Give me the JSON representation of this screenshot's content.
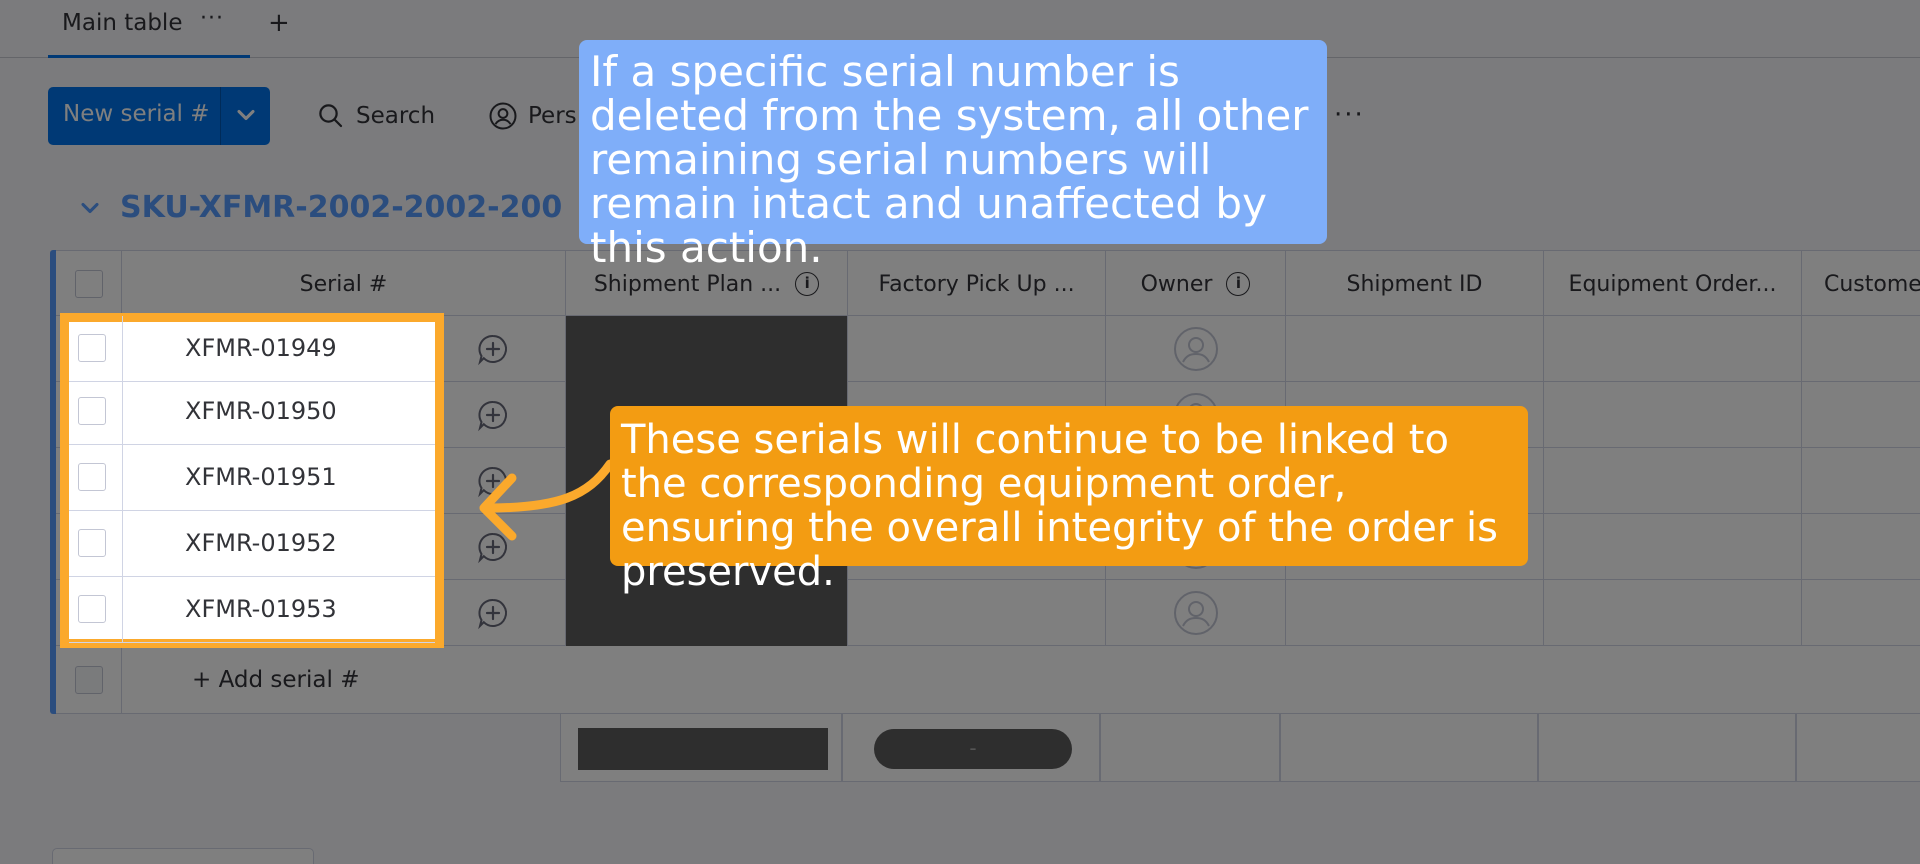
{
  "tabs": {
    "main_label": "Main table",
    "more": "···",
    "add": "+"
  },
  "toolbar": {
    "new_label": "New serial #",
    "search_label": "Search",
    "person_label": "Pers",
    "more": "···"
  },
  "group": {
    "title": "SKU-XFMR-2002-2002-200"
  },
  "columns": [
    "Serial #",
    "Shipment Plan ...",
    "Factory Pick Up ...",
    "Owner",
    "Shipment ID",
    "Equipment Order...",
    "Custome"
  ],
  "rows": [
    {
      "serial": "XFMR-01949"
    },
    {
      "serial": "XFMR-01950"
    },
    {
      "serial": "XFMR-01951"
    },
    {
      "serial": "XFMR-01952"
    },
    {
      "serial": "XFMR-01953"
    }
  ],
  "add_row_label": "+ Add serial #",
  "summary": {
    "pill_text": "-"
  },
  "callouts": {
    "blue": "If a specific serial number is deleted from the system, all other remaining serial numbers will remain intact and unaffected by this action.",
    "orange": "These serials will continue to be linked to the corresponding equipment order, ensuring the overall integrity of the order is preserved."
  },
  "colors": {
    "accent": "#0073ea",
    "group": "#579bfc",
    "highlight": "#fba92c",
    "callout_blue": "#7faef9",
    "callout_orange": "#f39c12"
  }
}
